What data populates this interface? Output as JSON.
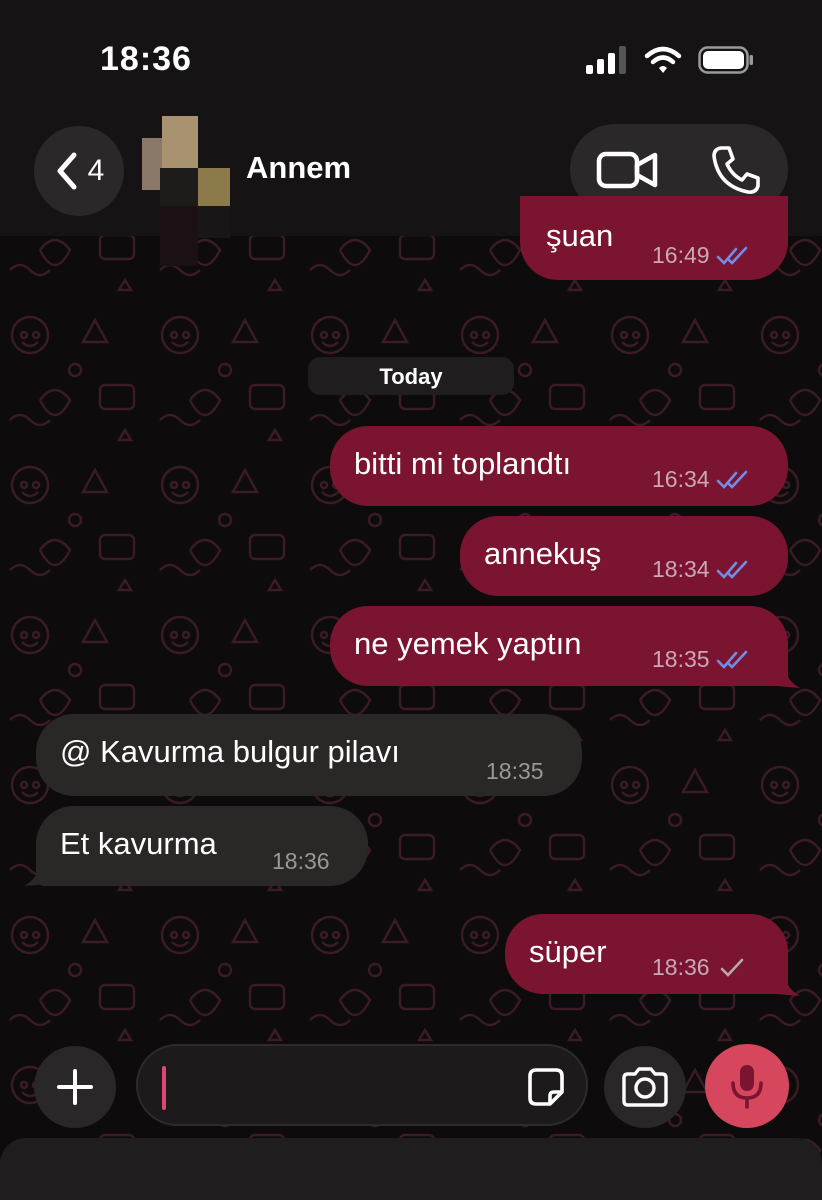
{
  "status_bar": {
    "time": "18:36"
  },
  "header": {
    "back_count": "4",
    "contact_name": "Annem"
  },
  "date_separator": "Today",
  "messages": [
    {
      "text": "şuan",
      "time": "16:49"
    },
    {
      "text": "bitti mi toplandtı",
      "time": "16:34"
    },
    {
      "text": "annekuş",
      "time": "18:34"
    },
    {
      "text": "ne yemek yaptın",
      "time": "18:35"
    },
    {
      "text": "@ Kavurma bulgur pilavı",
      "time": "18:35"
    },
    {
      "text": "Et kavurma",
      "time": "18:36"
    },
    {
      "text": "süper",
      "time": "18:36"
    }
  ],
  "composer": {
    "input_value": ""
  },
  "colors": {
    "outgoing_bubble": "#7a1430",
    "incoming_bubble": "#2a2727",
    "read_ticks": "#6f8fe8",
    "sent_tick": "#b9a8ae",
    "mic_button": "#d6475e"
  }
}
